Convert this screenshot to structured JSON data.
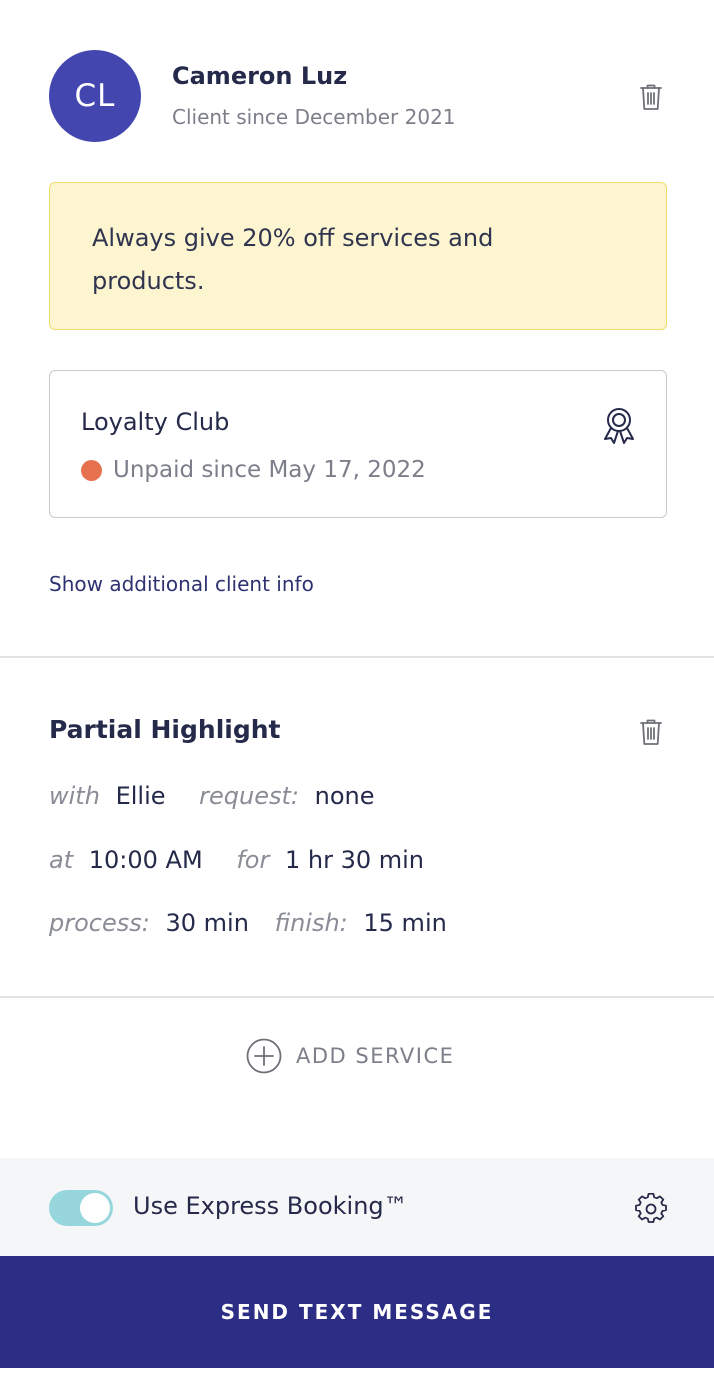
{
  "client": {
    "initials": "CL",
    "name": "Cameron Luz",
    "since": "Client since December 2021"
  },
  "note": {
    "text": "Always give 20% off services and products."
  },
  "loyalty": {
    "title": "Loyalty Club",
    "status": "Unpaid since May 17, 2022",
    "status_color": "#e5714e",
    "icon": "award-ribbon-icon"
  },
  "show_more_label": "Show additional client info",
  "service": {
    "title": "Partial Highlight",
    "with_label": "with",
    "with_value": "Ellie",
    "request_label": "request:",
    "request_value": "none",
    "at_label": "at",
    "at_value": "10:00 AM",
    "for_label": "for",
    "for_value": "1 hr 30 min",
    "process_label": "process:",
    "process_value": "30 min",
    "finish_label": "finish:",
    "finish_value": "15 min"
  },
  "add_service_label": "ADD SERVICE",
  "express": {
    "label": "Use Express Booking™",
    "enabled": true,
    "toggle_color": "#96d6dc"
  },
  "send_button_label": "SEND TEXT MESSAGE",
  "colors": {
    "primary": "#2c2e86",
    "avatar": "#4446b0",
    "note_bg": "#fdf5cf",
    "note_border": "#f2dc6a"
  }
}
